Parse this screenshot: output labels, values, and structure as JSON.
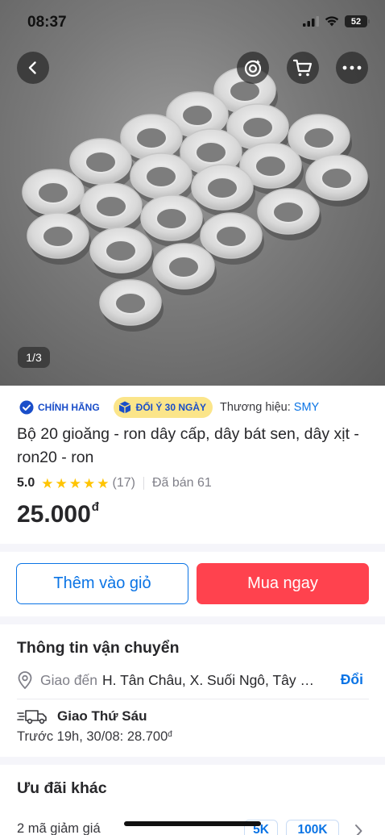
{
  "status_bar": {
    "time": "08:37",
    "battery": "52"
  },
  "product_image": {
    "counter": "1/3"
  },
  "header_actions": {
    "back_icon": "chevron-left-icon",
    "camera_icon": "camera-search-icon",
    "cart_icon": "cart-icon",
    "more_icon": "more-dots-icon"
  },
  "badges": {
    "official": "CHÍNH HÃNG",
    "return": "ĐỔI Ý 30 NGÀY"
  },
  "brand": {
    "label": "Thương hiệu: ",
    "name": "SMY"
  },
  "product": {
    "title": "Bộ 20 gioăng - ron dây cấp, dây bát sen, dây xịt - ron20 - ron",
    "rating": "5.0",
    "stars": 5,
    "review_count": "(17)",
    "sold": "Đã bán 61",
    "price": "25.000",
    "currency": "đ"
  },
  "actions": {
    "add_to_cart": "Thêm vào giỏ",
    "buy_now": "Mua ngay"
  },
  "shipping": {
    "title": "Thông tin vận chuyển",
    "deliver_to_prefix": "Giao đến",
    "address": "H. Tân Châu, X. Suối Ngô, Tây Ninh",
    "change_label": "Đổi",
    "delivery_day": "Giao Thứ Sáu",
    "delivery_detail": "Trước 19h, 30/08: 28.700",
    "delivery_currency": "đ"
  },
  "offers": {
    "title": "Ưu đãi khác",
    "coupon_text": "2 mã giảm giá",
    "chips": [
      "5K",
      "100K"
    ]
  },
  "colors": {
    "primary_blue": "#0b74e5",
    "buy_red": "#ff424e",
    "star_yellow": "#ffc400"
  }
}
